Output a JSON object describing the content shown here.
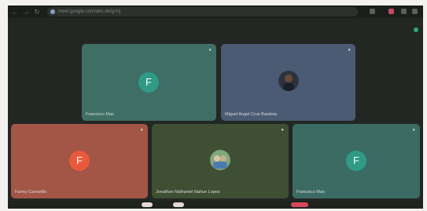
{
  "browser": {
    "url": "meet.google.com/abc-defg-hij",
    "nav": [
      "←",
      "→",
      "↻"
    ]
  },
  "tiles": [
    {
      "name": "Francisco Mao",
      "initial": "F",
      "color": "#3e6e64",
      "avatar_color": "#2f9a86",
      "type": "initial"
    },
    {
      "name": "Miguel Angel Cruz Bautista",
      "initial": "",
      "color": "#4a5b73",
      "avatar_color": "#2c3340",
      "type": "photo"
    },
    {
      "name": "Fanny Camarillo",
      "initial": "F",
      "color": "#a35546",
      "avatar_color": "#e85a3b",
      "type": "initial"
    },
    {
      "name": "Jonathan Nathaniel Nahue Lopez",
      "initial": "",
      "color": "#3f4f33",
      "avatar_color": "#5d8c57",
      "type": "photo"
    },
    {
      "name": "Francisco Mao",
      "initial": "F",
      "color": "#3b6b62",
      "avatar_color": "#2f9a86",
      "type": "initial"
    }
  ],
  "icons": {
    "mic": "mic-off-icon",
    "back": "back-arrow-icon",
    "forward": "forward-arrow-icon",
    "reload": "reload-icon"
  }
}
